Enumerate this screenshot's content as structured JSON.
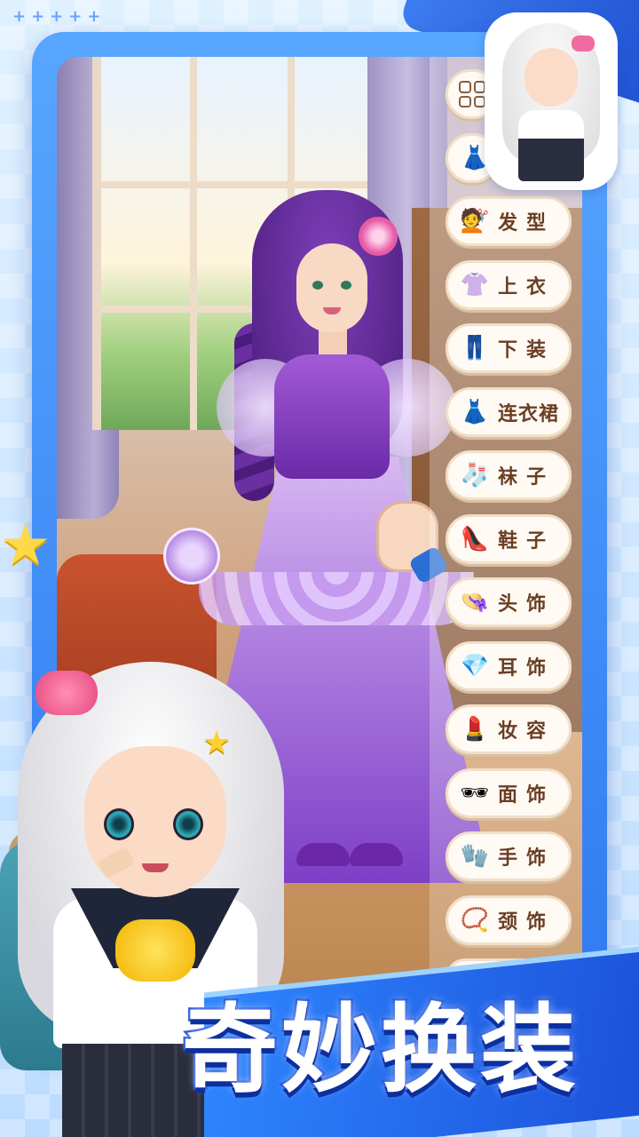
{
  "title": "奇妙换装",
  "menu": {
    "items": [
      {
        "id": "all",
        "icon": "grid-icon",
        "label": ""
      },
      {
        "id": "outfit",
        "icon": "dress-set-icon",
        "label": ""
      },
      {
        "id": "hair",
        "icon": "hair-icon",
        "label": "发型"
      },
      {
        "id": "top",
        "icon": "shirt-icon",
        "label": "上衣"
      },
      {
        "id": "bottom",
        "icon": "pants-icon",
        "label": "下装"
      },
      {
        "id": "dress",
        "icon": "dress-icon",
        "label": "连衣裙"
      },
      {
        "id": "socks",
        "icon": "socks-icon",
        "label": "袜子"
      },
      {
        "id": "shoes",
        "icon": "shoes-icon",
        "label": "鞋子"
      },
      {
        "id": "headwear",
        "icon": "hat-icon",
        "label": "头饰"
      },
      {
        "id": "earrings",
        "icon": "earring-icon",
        "label": "耳饰"
      },
      {
        "id": "makeup",
        "icon": "makeup-icon",
        "label": "妆容"
      },
      {
        "id": "face_accessory",
        "icon": "sunglasses-icon",
        "label": "面饰"
      },
      {
        "id": "hand_accessory",
        "icon": "glove-icon",
        "label": "手饰"
      },
      {
        "id": "necklace",
        "icon": "necklace-icon",
        "label": "颈饰"
      }
    ]
  },
  "colors": {
    "frame": "#3f8cff",
    "menu_bg": "#fffaf4",
    "menu_text": "#6b3e23",
    "title_fill": "#ffffff",
    "title_stroke": "#1a4fd8"
  }
}
